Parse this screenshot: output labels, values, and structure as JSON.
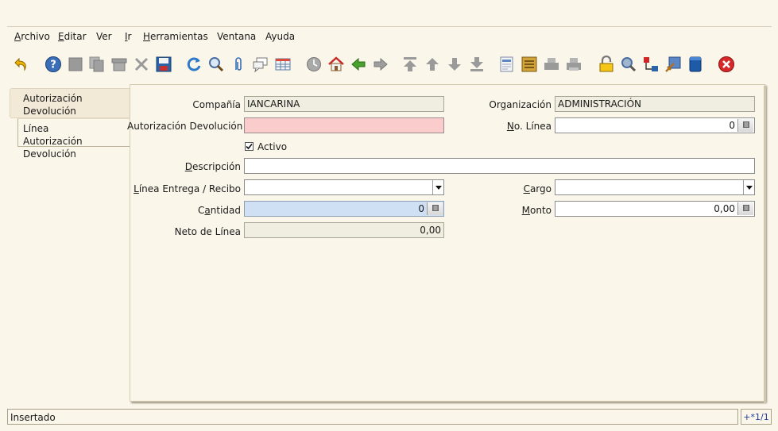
{
  "menu": {
    "items": [
      {
        "id": "archivo",
        "pre": "",
        "u": "A",
        "post": "rchivo"
      },
      {
        "id": "editar",
        "pre": "",
        "u": "E",
        "post": "ditar"
      },
      {
        "id": "ver",
        "pre": "Ver",
        "u": "",
        "post": ""
      },
      {
        "id": "ir",
        "pre": "",
        "u": "I",
        "post": "r"
      },
      {
        "id": "herramientas",
        "pre": "",
        "u": "H",
        "post": "erramientas"
      },
      {
        "id": "ventana",
        "pre": "Ventana",
        "u": "",
        "post": ""
      },
      {
        "id": "ayuda",
        "pre": "Ayuda",
        "u": "",
        "post": ""
      }
    ]
  },
  "toolbar": {
    "buttons": [
      "undo-icon",
      "help-icon",
      "new-record-icon",
      "copy-record-icon",
      "delete-record-icon",
      "delete-selection-icon",
      "save-icon",
      "refresh-icon",
      "find-icon",
      "attachment-icon",
      "chat-icon",
      "grid-toggle-icon",
      "history-icon",
      "home-icon",
      "back-icon",
      "forward-icon",
      "first-record-icon",
      "previous-record-icon",
      "next-record-icon",
      "last-record-icon",
      "report-icon",
      "archive-icon",
      "print-preview-icon",
      "print-icon",
      "lock-icon",
      "zoom-across-icon",
      "request-icon",
      "product-info-icon",
      "workflow-icon",
      "exit-icon"
    ]
  },
  "tabs": [
    {
      "line1": "Autorización",
      "line2": "Devolución Proveedor",
      "active": true
    },
    {
      "line1": "Línea",
      "line2": "Autorización Devolución",
      "active": false
    }
  ],
  "form": {
    "compania": {
      "label": "Compañía",
      "value": "IANCARINA"
    },
    "organizacion": {
      "label": "Organización",
      "value": "ADMINISTRACIÓN"
    },
    "autorizacion": {
      "label": "Autorización Devolución",
      "value": ""
    },
    "no_linea": {
      "label_u": "N",
      "label_rest": "o. Línea",
      "value": "0"
    },
    "activo": {
      "label": "Activo",
      "checked": true
    },
    "descripcion": {
      "label_u": "D",
      "label_rest": "escripción",
      "value": ""
    },
    "linea_entrega": {
      "label_u": "L",
      "label_rest": "ínea Entrega / Recibo",
      "value": ""
    },
    "cargo": {
      "label_u": "C",
      "label_rest": "argo",
      "value": ""
    },
    "cantidad": {
      "label_pre": "C",
      "label_u": "a",
      "label_rest": "ntidad",
      "value": "0"
    },
    "monto": {
      "label_u": "M",
      "label_rest": "onto",
      "value": "0,00"
    },
    "neto": {
      "label": "Neto de Línea",
      "value": "0,00"
    }
  },
  "status": {
    "message": "Insertado",
    "record": "+*1/1"
  },
  "colors": {
    "mandatory": "#fbcccc",
    "readonly": "#efeee0",
    "highlight": "#cfe0f5"
  }
}
